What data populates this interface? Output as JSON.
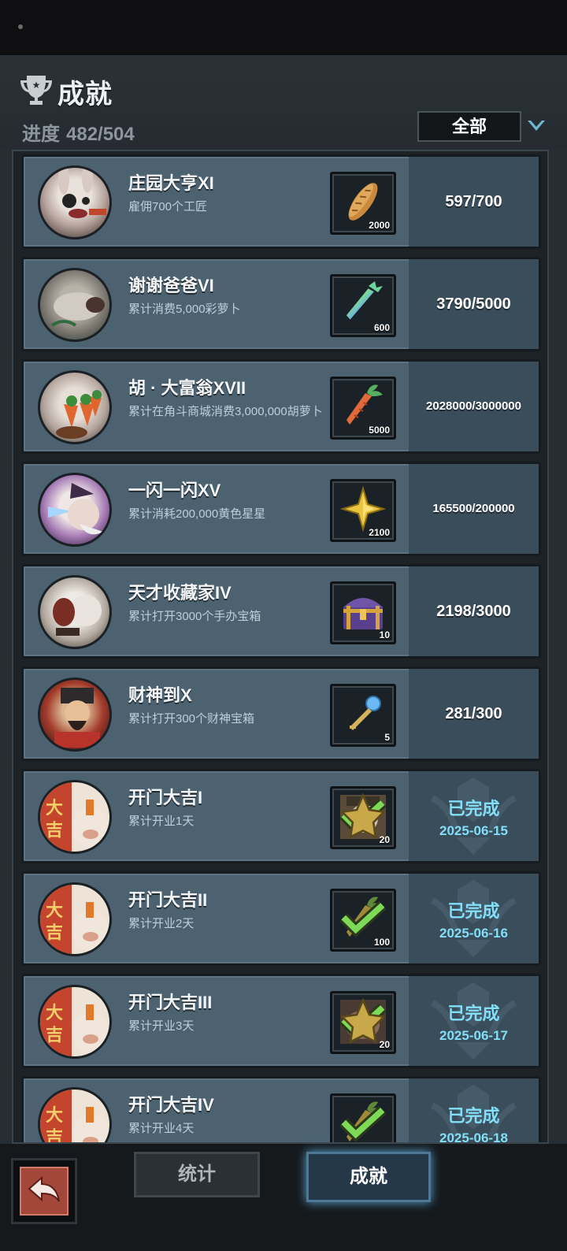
{
  "header": {
    "title": "成就",
    "progress_label": "进度",
    "progress_value": "482/504",
    "filter_value": "全部"
  },
  "achievements": [
    {
      "name": "庄园大亨XI",
      "desc": "雇佣700个工匠",
      "reward_icon": "bread-icon",
      "reward_qty": "2000",
      "progress": "597/700",
      "avatar": "rabbit-avatar"
    },
    {
      "name": "谢谢爸爸VI",
      "desc": "累计消费5,000彩萝卜",
      "reward_icon": "rainbow-carrot-icon",
      "reward_qty": "600",
      "progress": "3790/5000",
      "avatar": "pig-avatar"
    },
    {
      "name": "胡 · 大富翁XVII",
      "desc": "累计在角斗商城消费3,000,000胡萝卜",
      "reward_icon": "carrot-icon",
      "reward_qty": "5000",
      "progress": "2028000/3000000",
      "avatar": "rabbit-carrots-avatar"
    },
    {
      "name": "一闪一闪XV",
      "desc": "累计消耗200,000黄色星星",
      "reward_icon": "yellow-star-icon",
      "reward_qty": "2100",
      "progress": "165500/200000",
      "avatar": "wizard-avatar"
    },
    {
      "name": "天才收藏家IV",
      "desc": "累计打开3000个手办宝箱",
      "reward_icon": "treasure-chest-icon",
      "reward_qty": "10",
      "progress": "2198/3000",
      "avatar": "collector-avatar"
    },
    {
      "name": "财神到X",
      "desc": "累计打开300个财神宝箱",
      "reward_icon": "blue-key-icon",
      "reward_qty": "5",
      "progress": "281/300",
      "avatar": "fortune-god-avatar"
    },
    {
      "name": "开门大吉I",
      "desc": "累计开业1天",
      "reward_icon": "character-portrait-icon",
      "reward_qty": "20",
      "status": "已完成",
      "date": "2025-06-15",
      "avatar": "daji-avatar"
    },
    {
      "name": "开门大吉II",
      "desc": "累计开业2天",
      "reward_icon": "golden-carrot-icon",
      "reward_qty": "100",
      "status": "已完成",
      "date": "2025-06-16",
      "avatar": "daji-avatar"
    },
    {
      "name": "开门大吉III",
      "desc": "累计开业3天",
      "reward_icon": "monster-portrait-icon",
      "reward_qty": "20",
      "status": "已完成",
      "date": "2025-06-17",
      "avatar": "daji-avatar"
    },
    {
      "name": "开门大吉IV",
      "desc": "累计开业4天",
      "reward_icon": "golden-carrot-icon",
      "reward_qty": "",
      "status": "已完成",
      "date": "2025-06-18",
      "avatar": "daji-avatar"
    }
  ],
  "tabs": {
    "stats": "统计",
    "achievements": "成就"
  }
}
